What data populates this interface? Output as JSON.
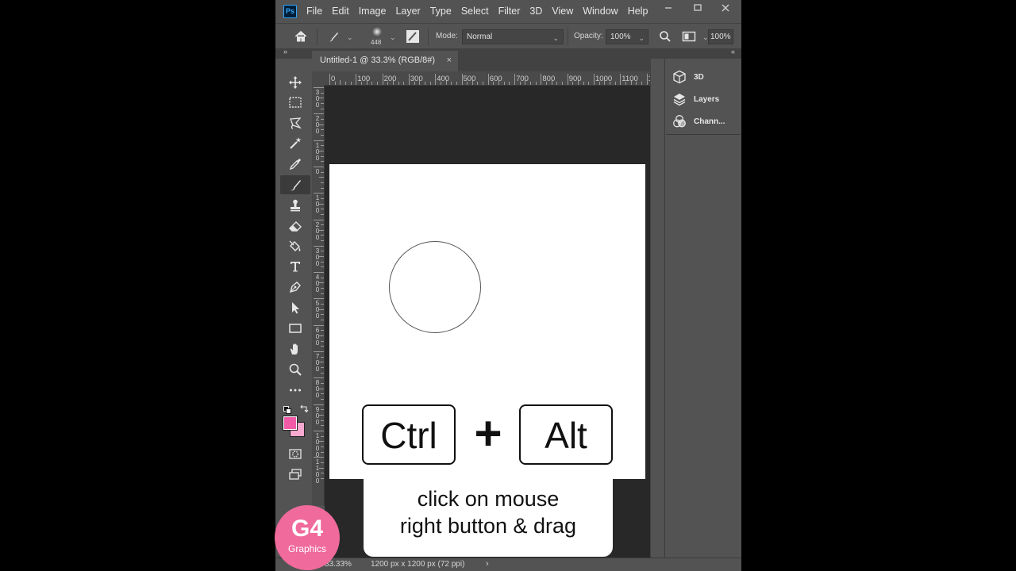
{
  "menu": {
    "logo": "Ps",
    "items": [
      "File",
      "Edit",
      "Image",
      "Layer",
      "Type",
      "Select",
      "Filter",
      "3D",
      "View",
      "Window",
      "Help"
    ]
  },
  "options": {
    "brush_size": "448",
    "mode_label": "Mode:",
    "mode_value": "Normal",
    "opacity_label": "Opacity:",
    "opacity_value": "100%",
    "flow_value": "100%"
  },
  "document": {
    "tab_title": "Untitled-1 @ 33.3% (RGB/8#)",
    "tab_close": "×"
  },
  "ruler": {
    "top_labels": [
      "0",
      "100",
      "200",
      "300",
      "400",
      "500",
      "600",
      "700",
      "800",
      "900",
      "1000",
      "1100",
      "1"
    ],
    "left_labels": [
      "300",
      "200",
      "100",
      "0",
      "100",
      "200",
      "300",
      "400",
      "500",
      "600",
      "700",
      "800",
      "900",
      "1000",
      "1100"
    ]
  },
  "panels": {
    "items": [
      "3D",
      "Layers",
      "Chann..."
    ]
  },
  "status": {
    "zoom": "33.33%",
    "doc_size": "1200 px x 1200 px (72 ppi)",
    "arrow": "›"
  },
  "overlay": {
    "key1": "Ctrl",
    "plus": "+",
    "key2": "Alt",
    "caption_line1": "click on mouse",
    "caption_line2": "right button & drag",
    "logo_main": "G4",
    "logo_sub": "Graphics"
  },
  "colors": {
    "foreground": "#f25aa8",
    "background": "#f7a9cf",
    "logo": "#f06a9b"
  }
}
